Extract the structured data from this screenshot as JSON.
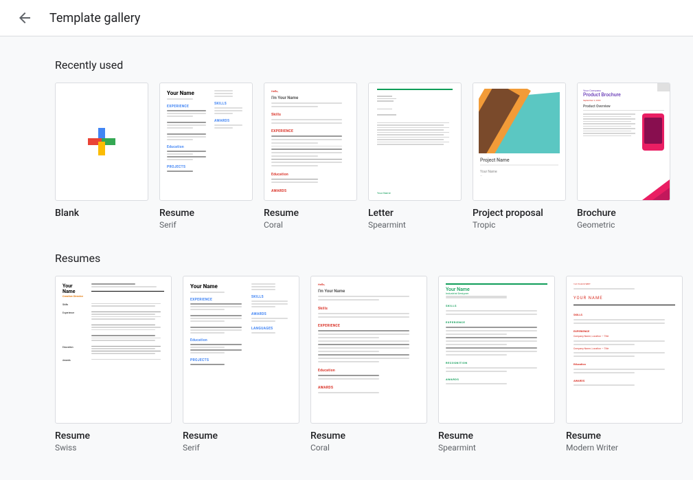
{
  "header": {
    "title": "Template gallery"
  },
  "sections": {
    "recent": {
      "title": "Recently used",
      "items": [
        {
          "title": "Blank",
          "subtitle": ""
        },
        {
          "title": "Resume",
          "subtitle": "Serif"
        },
        {
          "title": "Resume",
          "subtitle": "Coral"
        },
        {
          "title": "Letter",
          "subtitle": "Spearmint"
        },
        {
          "title": "Project proposal",
          "subtitle": "Tropic"
        },
        {
          "title": "Brochure",
          "subtitle": "Geometric"
        }
      ]
    },
    "resumes": {
      "title": "Resumes",
      "items": [
        {
          "title": "Resume",
          "subtitle": "Swiss"
        },
        {
          "title": "Resume",
          "subtitle": "Serif"
        },
        {
          "title": "Resume",
          "subtitle": "Coral"
        },
        {
          "title": "Resume",
          "subtitle": "Spearmint"
        },
        {
          "title": "Resume",
          "subtitle": "Modern Writer"
        }
      ]
    }
  },
  "thumbs": {
    "yourName": "Your Name",
    "imYourName": "I'm Your Name",
    "hello": "Hello,",
    "skills": "Skills",
    "experience": "EXPERIENCE",
    "education": "Education",
    "awards": "AWARDS",
    "projects": "PROJECTS",
    "projectName": "Project Name",
    "yourCompany": "Your Company",
    "productBrochure": "Product Brochure",
    "productOverview": "Product Overview",
    "creativeDirector": "Creative Director",
    "industrialDesigner": "Industrial Designer",
    "skillsLabel": "SKILLS",
    "experienceLabel": "EXPERIENCE",
    "projectsLabel": "PROJECTS",
    "recognitionLabel": "RECOGNITION",
    "yourNameUpper": "YOUR NAME"
  }
}
